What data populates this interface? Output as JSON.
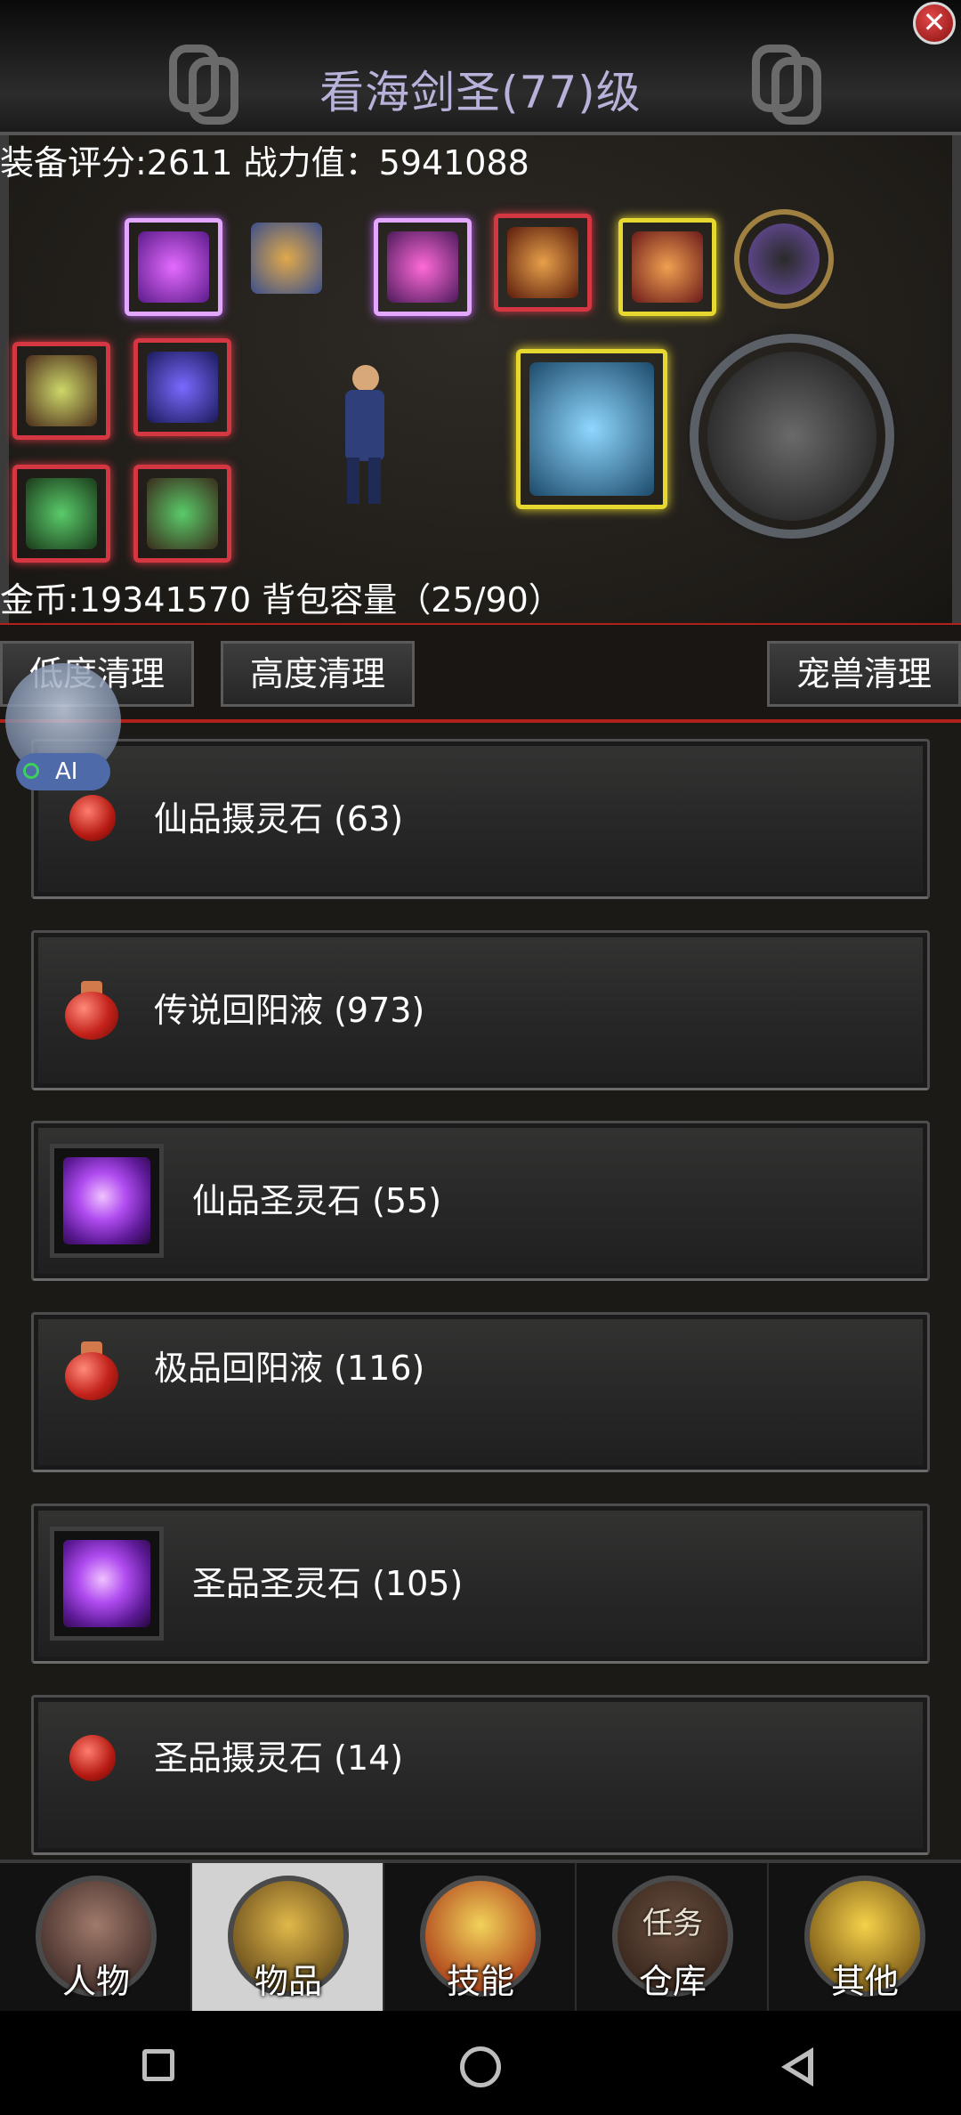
{
  "header": {
    "title": "看海剑圣(77)级",
    "close_icon": "close-icon"
  },
  "stats": {
    "score_line": "装备评分:2611 战力值：5941088",
    "gold_line": "金币:19341570 背包容量（25/90）"
  },
  "cleanup": {
    "low_label": "低度清理",
    "high_label": "高度清理",
    "pet_label": "宠兽清理"
  },
  "ai_badge": {
    "label": "AI"
  },
  "items": [
    {
      "label": "仙品摄灵石 (63)",
      "icon": "red-stone-icon"
    },
    {
      "label": "传说回阳液 (973)",
      "icon": "red-potion-icon"
    },
    {
      "label": "仙品圣灵石 (55)",
      "icon": "purple-crystal-icon"
    },
    {
      "label": "极品回阳液 (116)",
      "icon": "red-potion-icon"
    },
    {
      "label": "圣品圣灵石 (105)",
      "icon": "purple-crystal-icon"
    },
    {
      "label": "圣品摄灵石 (14)",
      "icon": "red-stone-icon"
    }
  ],
  "nav": [
    {
      "label": "人物",
      "icon": "character-icon"
    },
    {
      "label": "物品",
      "icon": "items-icon",
      "active": true
    },
    {
      "label": "技能",
      "icon": "skills-icon"
    },
    {
      "label": "仓库",
      "icon": "warehouse-icon",
      "overlay": "任务"
    },
    {
      "label": "其他",
      "icon": "trophy-icon"
    }
  ],
  "colors": {
    "title": "#b7b2da",
    "accent_red": "#b0211b",
    "slot_red": "#d43742",
    "slot_gold": "#e7d830"
  }
}
